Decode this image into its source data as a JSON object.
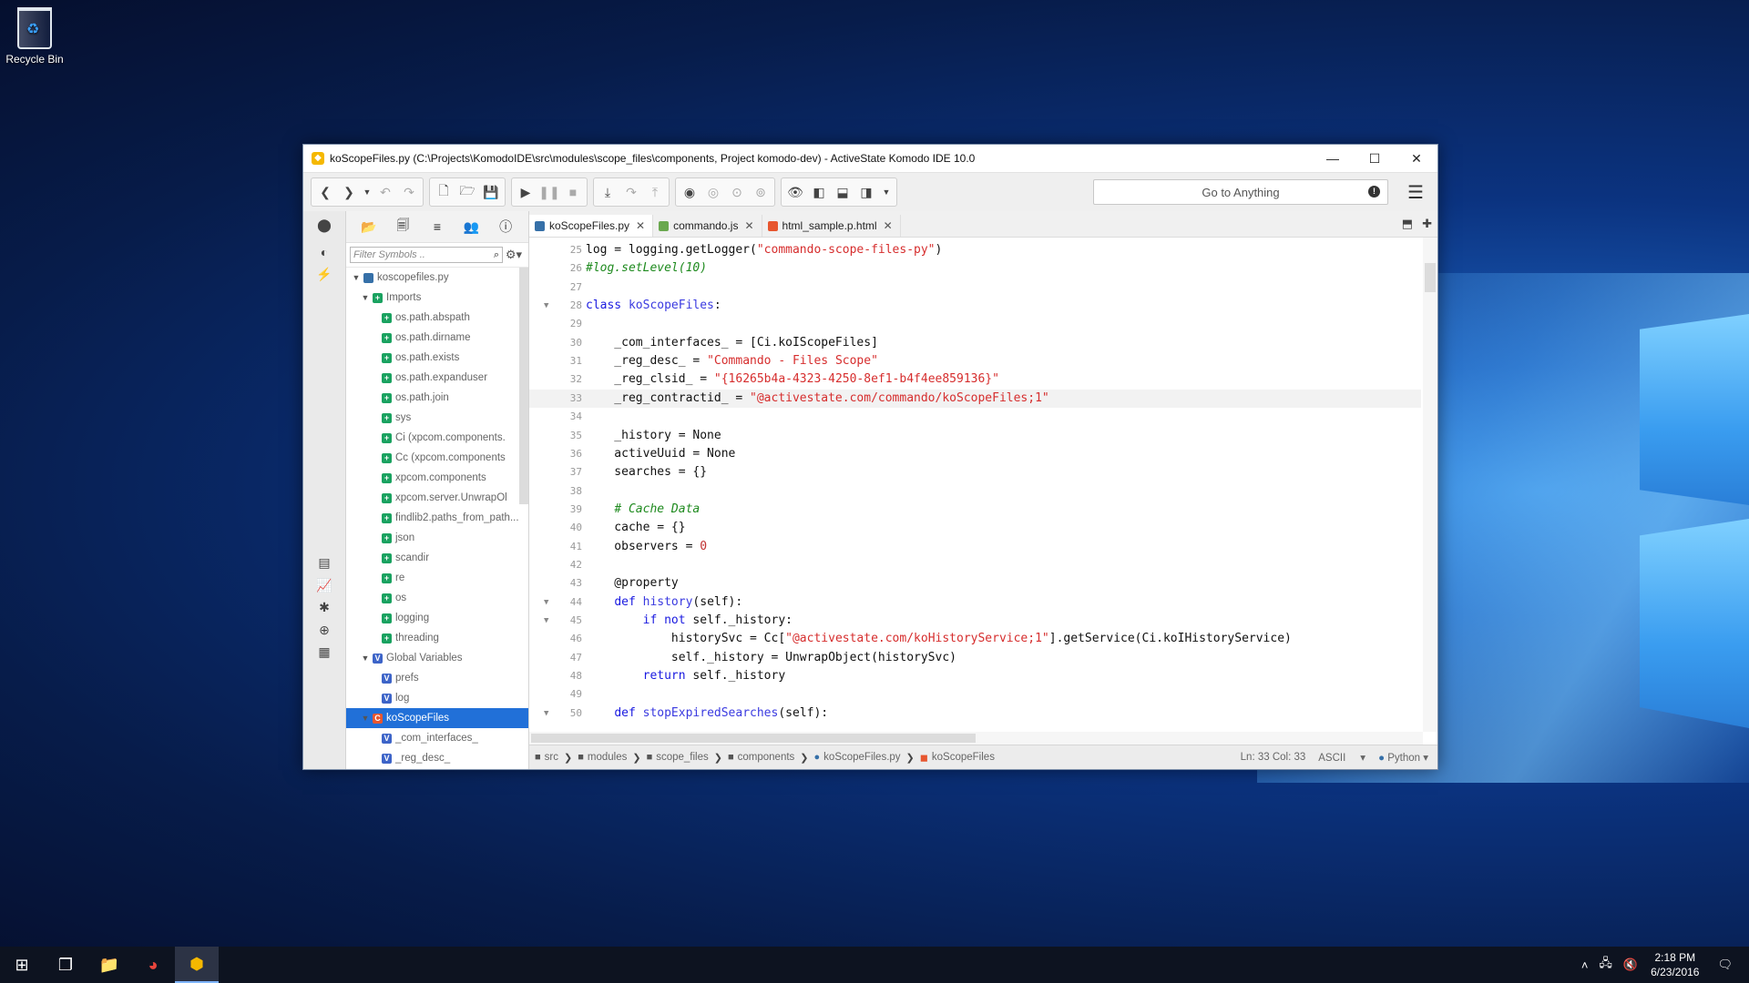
{
  "desktop": {
    "recycle_bin_label": "Recycle Bin"
  },
  "window": {
    "title": "koScopeFiles.py (C:\\Projects\\KomodoIDE\\src\\modules\\scope_files\\components, Project komodo-dev) - ActiveState Komodo IDE 10.0",
    "minimize": "—",
    "maximize": "☐",
    "close": "✕"
  },
  "toolbar": {
    "goto_placeholder": "Go to Anything",
    "goto_info": "!"
  },
  "sidebar": {
    "filter_placeholder": "Filter Symbols ..",
    "tree": [
      {
        "level": 0,
        "tw": "▼",
        "badge": "py",
        "label": "koscopefiles.py"
      },
      {
        "level": 1,
        "tw": "▼",
        "badge": "imp",
        "label": "Imports"
      },
      {
        "level": 2,
        "tw": "",
        "badge": "imp",
        "label": "os.path.abspath"
      },
      {
        "level": 2,
        "tw": "",
        "badge": "imp",
        "label": "os.path.dirname"
      },
      {
        "level": 2,
        "tw": "",
        "badge": "imp",
        "label": "os.path.exists"
      },
      {
        "level": 2,
        "tw": "",
        "badge": "imp",
        "label": "os.path.expanduser"
      },
      {
        "level": 2,
        "tw": "",
        "badge": "imp",
        "label": "os.path.join"
      },
      {
        "level": 2,
        "tw": "",
        "badge": "imp",
        "label": "sys"
      },
      {
        "level": 2,
        "tw": "",
        "badge": "imp",
        "label": "Ci (xpcom.components."
      },
      {
        "level": 2,
        "tw": "",
        "badge": "imp",
        "label": "Cc (xpcom.components"
      },
      {
        "level": 2,
        "tw": "",
        "badge": "imp",
        "label": "xpcom.components"
      },
      {
        "level": 2,
        "tw": "",
        "badge": "imp",
        "label": "xpcom.server.UnwrapOl"
      },
      {
        "level": 2,
        "tw": "",
        "badge": "imp",
        "label": "findlib2.paths_from_path..."
      },
      {
        "level": 2,
        "tw": "",
        "badge": "imp",
        "label": "json"
      },
      {
        "level": 2,
        "tw": "",
        "badge": "imp",
        "label": "scandir"
      },
      {
        "level": 2,
        "tw": "",
        "badge": "imp",
        "label": "re"
      },
      {
        "level": 2,
        "tw": "",
        "badge": "imp",
        "label": "os"
      },
      {
        "level": 2,
        "tw": "",
        "badge": "imp",
        "label": "logging"
      },
      {
        "level": 2,
        "tw": "",
        "badge": "imp",
        "label": "threading"
      },
      {
        "level": 1,
        "tw": "▼",
        "badge": "var",
        "label": "Global Variables"
      },
      {
        "level": 2,
        "tw": "",
        "badge": "var",
        "label": "prefs"
      },
      {
        "level": 2,
        "tw": "",
        "badge": "var",
        "label": "log"
      },
      {
        "level": 1,
        "tw": "▼",
        "badge": "cls",
        "label": "koScopeFiles",
        "selected": true
      },
      {
        "level": 2,
        "tw": "",
        "badge": "var",
        "label": "_com_interfaces_"
      },
      {
        "level": 2,
        "tw": "",
        "badge": "var",
        "label": "_reg_desc_"
      }
    ]
  },
  "tabs": [
    {
      "label": "koScopeFiles.py",
      "icon": "python-file-icon",
      "active": true,
      "close": "✕"
    },
    {
      "label": "commando.js",
      "icon": "js-file-icon",
      "active": false,
      "close": "✕"
    },
    {
      "label": "html_sample.p.html",
      "icon": "html-file-icon",
      "active": false,
      "close": "✕"
    }
  ],
  "code": [
    {
      "n": "25",
      "html": "log = logging.getLogger(<span class=\"str\">\"commando-scope-files-py\"</span>)"
    },
    {
      "n": "26",
      "html": "<span class=\"cm\">#log.setLevel(10)</span>"
    },
    {
      "n": "27",
      "html": ""
    },
    {
      "n": "28",
      "fold": true,
      "html": "<span class=\"kw\">class</span> <span class=\"cls\">koScopeFiles</span>:"
    },
    {
      "n": "29",
      "html": ""
    },
    {
      "n": "30",
      "html": "    _com_interfaces_ = [Ci.koIScopeFiles]"
    },
    {
      "n": "31",
      "html": "    _reg_desc_ = <span class=\"str\">\"Commando - Files Scope\"</span>"
    },
    {
      "n": "32",
      "html": "    _reg_clsid_ = <span class=\"str\">\"{16265b4a-4323-4250-8ef1-b4f4ee859136}\"</span>"
    },
    {
      "n": "33",
      "cur": true,
      "html": "    _reg_contractid_ = <span class=\"str\">\"@activestate.com/commando/koScopeFiles;1\"</span>"
    },
    {
      "n": "34",
      "html": ""
    },
    {
      "n": "35",
      "html": "    _history = None"
    },
    {
      "n": "36",
      "html": "    activeUuid = None"
    },
    {
      "n": "37",
      "html": "    searches = {}"
    },
    {
      "n": "38",
      "html": ""
    },
    {
      "n": "39",
      "html": "    <span class=\"cm\"># Cache Data</span>"
    },
    {
      "n": "40",
      "html": "    cache = {}"
    },
    {
      "n": "41",
      "html": "    observers = <span class=\"num\">0</span>"
    },
    {
      "n": "42",
      "html": ""
    },
    {
      "n": "43",
      "html": "    @property"
    },
    {
      "n": "44",
      "fold": true,
      "html": "    <span class=\"kw\">def</span> <span class=\"fn\">history</span>(self):"
    },
    {
      "n": "45",
      "fold": true,
      "html": "        <span class=\"kw\">if not</span> self._history:"
    },
    {
      "n": "46",
      "html": "            historySvc = Cc[<span class=\"str\">\"@activestate.com/koHistoryService;1\"</span>].getService(Ci.koIHistoryService)"
    },
    {
      "n": "47",
      "html": "            self._history = UnwrapObject(historySvc)"
    },
    {
      "n": "48",
      "html": "        <span class=\"kw\">return</span> self._history"
    },
    {
      "n": "49",
      "html": ""
    },
    {
      "n": "50",
      "fold": true,
      "html": "    <span class=\"kw\">def</span> <span class=\"fn\">stopExpiredSearches</span>(self):"
    }
  ],
  "status": {
    "crumbs": [
      "src",
      "modules",
      "scope_files",
      "components",
      "koScopeFiles.py",
      "koScopeFiles"
    ],
    "position": "Ln: 33 Col: 33",
    "encoding": "ASCII",
    "language": "Python"
  },
  "taskbar": {
    "time": "2:18 PM",
    "date": "6/23/2016"
  }
}
